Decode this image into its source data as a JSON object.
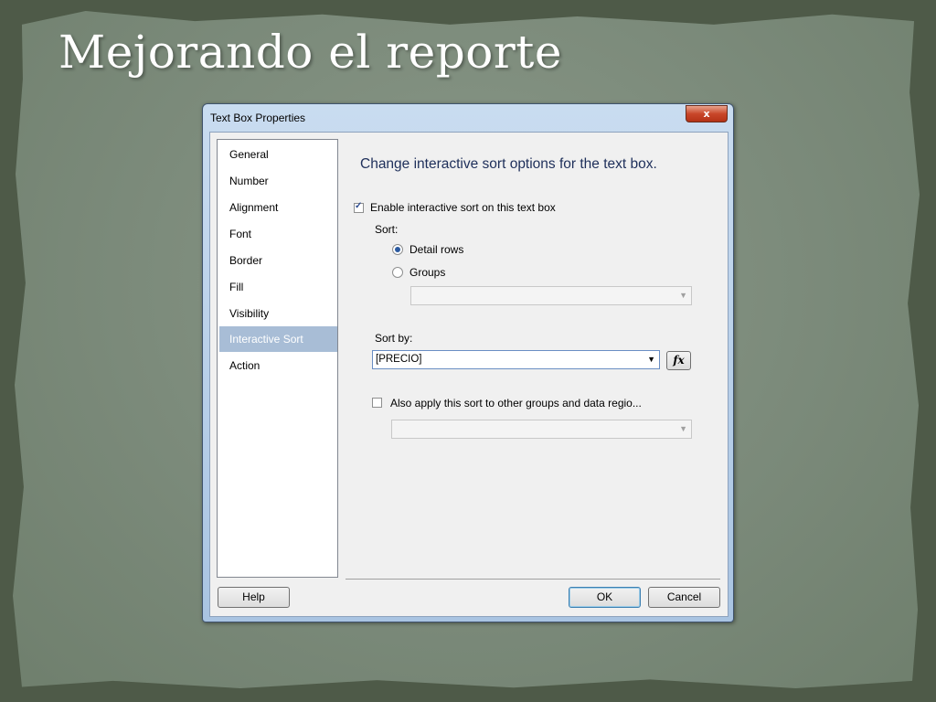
{
  "slide": {
    "title": "Mejorando el reporte"
  },
  "dialog": {
    "title": "Text Box Properties",
    "close_label": "x",
    "nav": [
      {
        "label": "General"
      },
      {
        "label": "Number"
      },
      {
        "label": "Alignment"
      },
      {
        "label": "Font"
      },
      {
        "label": "Border"
      },
      {
        "label": "Fill"
      },
      {
        "label": "Visibility"
      },
      {
        "label": "Interactive Sort",
        "selected": true
      },
      {
        "label": "Action"
      }
    ],
    "heading": "Change interactive sort options for the text box.",
    "enable_sort": {
      "label": "Enable interactive sort on this text box",
      "checked": true
    },
    "sort_label": "Sort:",
    "sort_options": [
      {
        "label": "Detail rows",
        "selected": true
      },
      {
        "label": "Groups",
        "selected": false
      }
    ],
    "groups_combo": {
      "value": ""
    },
    "sort_by_label": "Sort by:",
    "sort_by_combo": {
      "value": "[PRECIO]"
    },
    "fx_label": "fx",
    "apply_other": {
      "label": "Also apply this sort to other groups and data regio...",
      "checked": false
    },
    "other_combo": {
      "value": ""
    },
    "buttons": {
      "help": "Help",
      "ok": "OK",
      "cancel": "Cancel"
    }
  },
  "colors": {
    "title_bar": "#b9d1ea",
    "selected_nav": "#a8bdd6",
    "close_button": "#c9472a",
    "background": "#7b8a7a"
  }
}
